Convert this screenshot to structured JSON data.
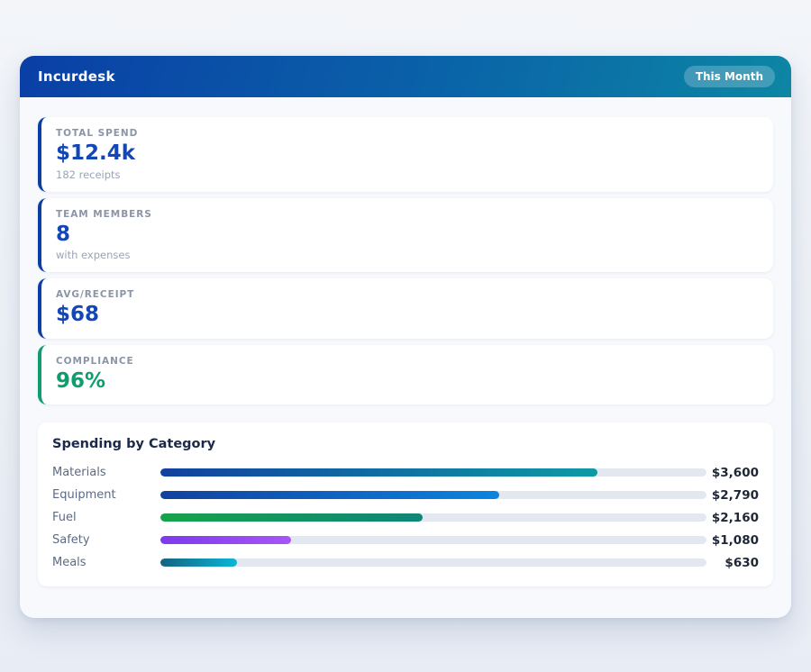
{
  "header": {
    "title": "Incurdesk",
    "badge": "This Month"
  },
  "stats": [
    {
      "label": "TOTAL SPEND",
      "value": "$12.4k",
      "sub": "182 receipts",
      "accent": "#0b3fa6",
      "value_color": "#1347b8"
    },
    {
      "label": "TEAM MEMBERS",
      "value": "8",
      "sub": "with expenses",
      "accent": "#0b3fa6",
      "value_color": "#1347b8"
    },
    {
      "label": "AVG/RECEIPT",
      "value": "$68",
      "sub": "",
      "accent": "#0b3fa6",
      "value_color": "#1347b8"
    },
    {
      "label": "COMPLIANCE",
      "value": "96%",
      "sub": "",
      "accent": "#0e9d6e",
      "value_color": "#0e9d6e"
    }
  ],
  "chart_data": {
    "type": "bar",
    "orientation": "horizontal",
    "title": "Spending by Category",
    "categories": [
      "Materials",
      "Equipment",
      "Fuel",
      "Safety",
      "Meals"
    ],
    "values": [
      3600,
      2790,
      2160,
      1080,
      630
    ],
    "value_labels": [
      "$3,600",
      "$2,790",
      "$2,160",
      "$1,080",
      "$630"
    ],
    "scale_max": 4500,
    "track_color": "#e3e8f0",
    "bar_colors": [
      {
        "from": "#12419f",
        "to": "#0e9aa4"
      },
      {
        "from": "#12419f",
        "to": "#0b84e0"
      },
      {
        "from": "#16a34a",
        "to": "#0f8578"
      },
      {
        "from": "#7c3aed",
        "to": "#a855f7"
      },
      {
        "from": "#14647f",
        "to": "#0ab6d8"
      }
    ]
  },
  "colors": {
    "header_gradient_from": "#0a3fa6",
    "header_gradient_to": "#0d86a4",
    "accent_blue": "#0b3fa6",
    "accent_green": "#0e9d6e",
    "panel_bg": "#f7f9fc"
  }
}
